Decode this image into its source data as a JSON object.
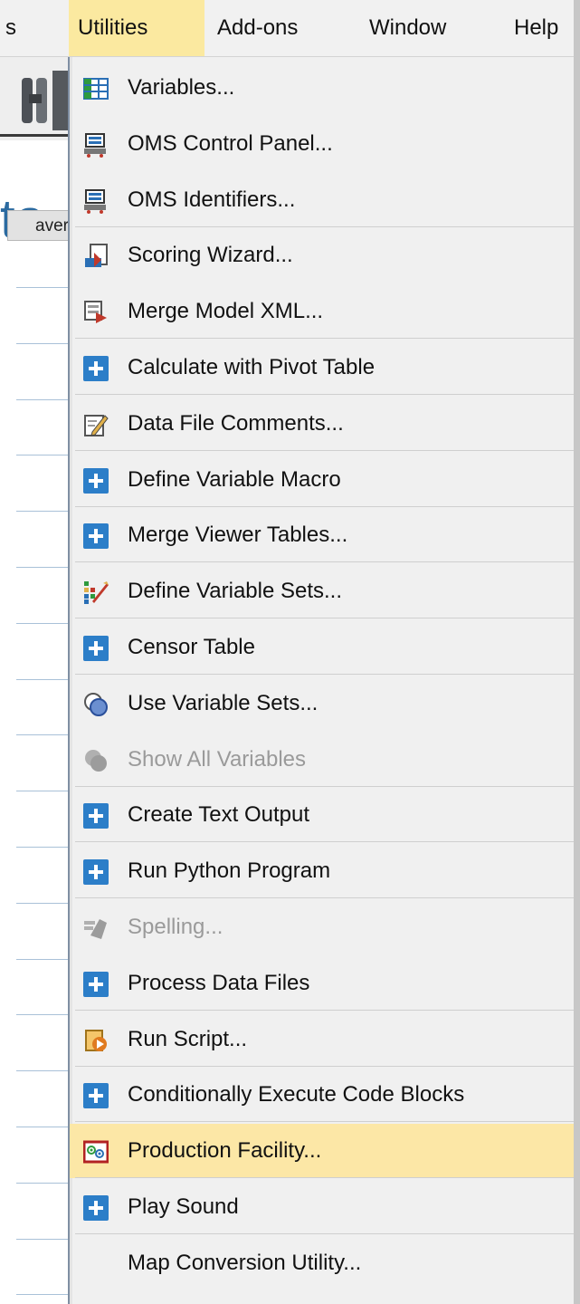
{
  "menubar": {
    "items": [
      {
        "label": "s"
      },
      {
        "label": "Utilities"
      },
      {
        "label": "Add-ons"
      },
      {
        "label": "Window"
      },
      {
        "label": "Help"
      }
    ]
  },
  "background": {
    "title_fragment": "ta",
    "column_header": "aver"
  },
  "menu": {
    "items": [
      {
        "label": "Variables...",
        "icon": "variables-grid-icon",
        "enabled": true
      },
      {
        "label": "OMS Control Panel...",
        "icon": "oms-control-panel-icon",
        "enabled": true
      },
      {
        "label": "OMS Identifiers...",
        "icon": "oms-identifiers-icon",
        "enabled": true
      },
      {
        "label": "Scoring Wizard...",
        "icon": "scoring-wizard-icon",
        "enabled": true
      },
      {
        "label": "Merge Model XML...",
        "icon": "merge-model-xml-icon",
        "enabled": true
      },
      {
        "label": "Calculate with Pivot Table",
        "icon": "extension-plus-icon",
        "enabled": true
      },
      {
        "label": "Data File Comments...",
        "icon": "comments-pencil-icon",
        "enabled": true
      },
      {
        "label": "Define Variable Macro",
        "icon": "extension-plus-icon",
        "enabled": true
      },
      {
        "label": "Merge Viewer Tables...",
        "icon": "extension-plus-icon",
        "enabled": true
      },
      {
        "label": "Define Variable Sets...",
        "icon": "variable-sets-icon",
        "enabled": true
      },
      {
        "label": "Censor Table",
        "icon": "extension-plus-icon",
        "enabled": true
      },
      {
        "label": "Use Variable Sets...",
        "icon": "use-variable-sets-icon",
        "enabled": true
      },
      {
        "label": "Show All Variables",
        "icon": "show-all-variables-icon",
        "enabled": false
      },
      {
        "label": "Create Text Output",
        "icon": "extension-plus-icon",
        "enabled": true
      },
      {
        "label": "Run Python Program",
        "icon": "extension-plus-icon",
        "enabled": true
      },
      {
        "label": "Spelling...",
        "icon": "spelling-icon",
        "enabled": false
      },
      {
        "label": "Process Data Files",
        "icon": "extension-plus-icon",
        "enabled": true
      },
      {
        "label": "Run Script...",
        "icon": "run-script-icon",
        "enabled": true
      },
      {
        "label": "Conditionally Execute Code Blocks",
        "icon": "extension-plus-icon",
        "enabled": true
      },
      {
        "label": "Production Facility...",
        "icon": "production-facility-icon",
        "enabled": true,
        "highlighted": true
      },
      {
        "label": "Play Sound",
        "icon": "extension-plus-icon",
        "enabled": true
      },
      {
        "label": "Map Conversion Utility...",
        "icon": "",
        "enabled": true
      }
    ]
  },
  "colors": {
    "highlight": "#fce7a6",
    "plus_icon": "#2c7ec8",
    "menu_bg": "#f0f0f0"
  }
}
